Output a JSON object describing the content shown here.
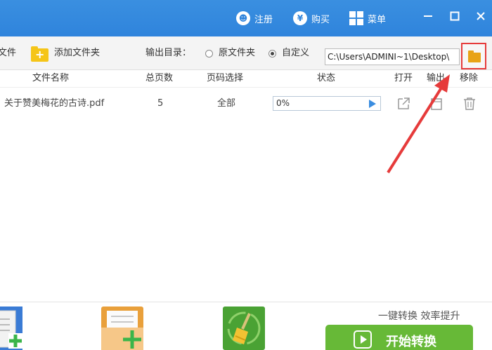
{
  "titlebar": {
    "register_label": "注册",
    "register_icon": "user-icon",
    "buy_label": "购买",
    "buy_icon": "yen-icon",
    "menu_label": "菜单",
    "menu_icon": "grid-icon",
    "minimize_icon": "minimize-icon",
    "maximize_icon": "maximize-icon",
    "close_icon": "close-icon",
    "background_color": "#2f84dc"
  },
  "toolbar": {
    "add_file_partial": "文件",
    "add_folder_label": "添加文件夹",
    "output_dir_label": "输出目录：",
    "option_original": "原文件夹",
    "option_custom": "自定义",
    "selected_option": "自定义",
    "path_value": "C:\\Users\\ADMINI~1\\Desktop\\",
    "browse_icon": "folder-icon",
    "highlight_color": "#e63b3b"
  },
  "table": {
    "headers": {
      "name": "文件名称",
      "pages": "总页数",
      "page_select": "页码选择",
      "status": "状态",
      "open": "打开",
      "output": "输出",
      "remove": "移除"
    },
    "rows": [
      {
        "name": "关于赞美梅花的古诗.pdf",
        "pages": "5",
        "page_select": "全部",
        "progress_text": "0%",
        "progress": 0
      }
    ]
  },
  "bottom": {
    "slogan": "一键转换  效率提升",
    "start_label": "开始转换",
    "start_color": "#67b937",
    "tools": [
      "add-file-icon",
      "add-folder-icon",
      "clear-list-icon"
    ]
  },
  "annotation": {
    "type": "red-arrow",
    "color": "#e63b3b"
  }
}
